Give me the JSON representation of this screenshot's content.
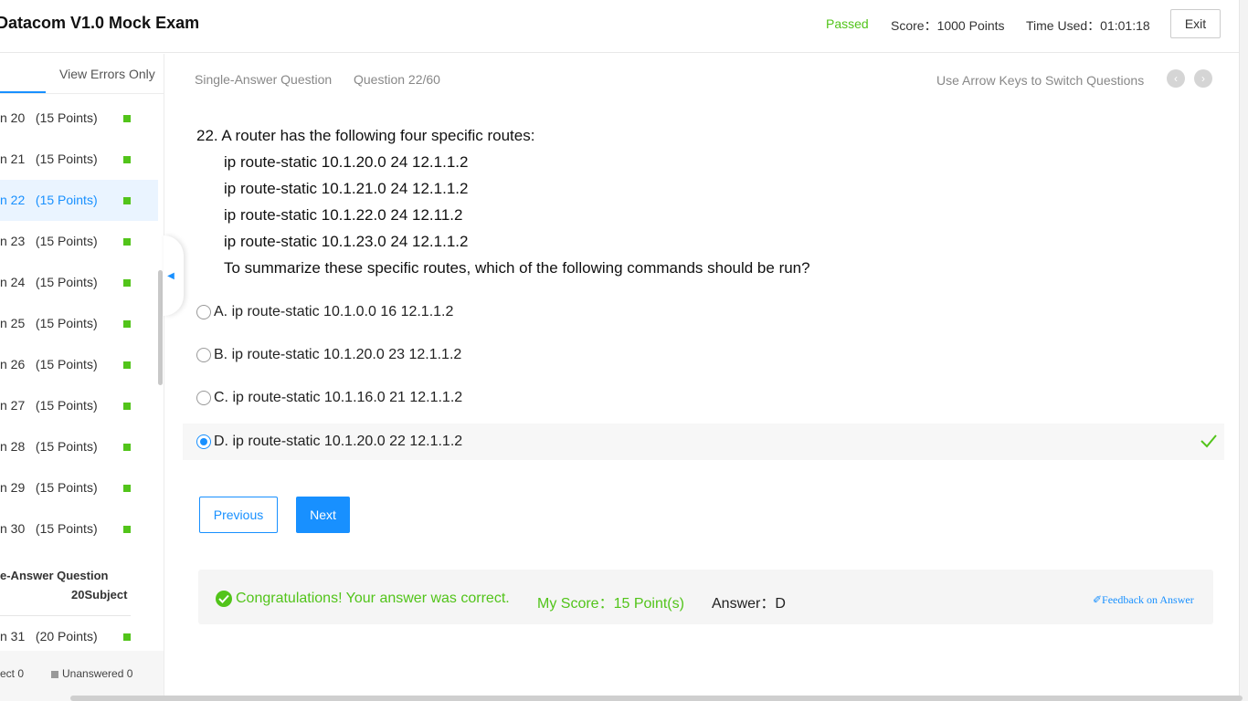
{
  "header": {
    "title": "Datacom V1.0 Mock Exam",
    "status": "Passed",
    "score": "Score：1000 Points",
    "time_used": "Time Used：01:01:18",
    "exit_label": "Exit"
  },
  "sidebar": {
    "view_errors_label": "View Errors Only",
    "items": [
      {
        "label": "n 20   (15 Points)"
      },
      {
        "label": "n 21   (15 Points)"
      },
      {
        "label": "n 22   (15 Points)"
      },
      {
        "label": "n 23   (15 Points)"
      },
      {
        "label": "n 24   (15 Points)"
      },
      {
        "label": "n 25   (15 Points)"
      },
      {
        "label": "n 26   (15 Points)"
      },
      {
        "label": "n 27   (15 Points)"
      },
      {
        "label": "n 28   (15 Points)"
      },
      {
        "label": "n 29   (15 Points)"
      },
      {
        "label": "n 30   (15 Points)"
      }
    ],
    "section_title": "e-Answer Question",
    "section_sub": "20Subject",
    "item_31": "n 31   (20 Points)",
    "footer_correct": "ect 0",
    "footer_unanswered": "Unanswered 0"
  },
  "question": {
    "type": "Single-Answer Question",
    "number": "Question 22/60",
    "hint": "Use Arrow Keys to Switch Questions",
    "stem_first": "22. A router has the following four specific routes:",
    "route_1": "ip route-static 10.1.20.0 24 12.1.1.2",
    "route_2": "ip route-static 10.1.21.0 24 12.1.1.2",
    "route_3": "ip route-static 10.1.22.0 24 12.11.2",
    "route_4": "ip route-static 10.1.23.0 24 12.1.1.2",
    "stem_last": "To summarize these specific routes, which of the following commands should be run?",
    "options": [
      {
        "text": "A. ip route-static 10.1.0.0 16 12.1.1.2"
      },
      {
        "text": "B. ip route-static 10.1.20.0 23 12.1.1.2"
      },
      {
        "text": "C. ip route-static 10.1.16.0 21 12.1.1.2"
      },
      {
        "text": "D. ip route-static 10.1.20.0 22 12.1.1.2"
      }
    ]
  },
  "buttons": {
    "previous": "Previous",
    "next": "Next"
  },
  "result": {
    "message": "Congratulations! Your answer was correct.",
    "my_score": "My Score：15 Point(s)",
    "answer": "Answer：D",
    "feedback": "✐Feedback on Answer"
  },
  "colors": {
    "accent": "#1890ff",
    "success": "#52c41a"
  }
}
